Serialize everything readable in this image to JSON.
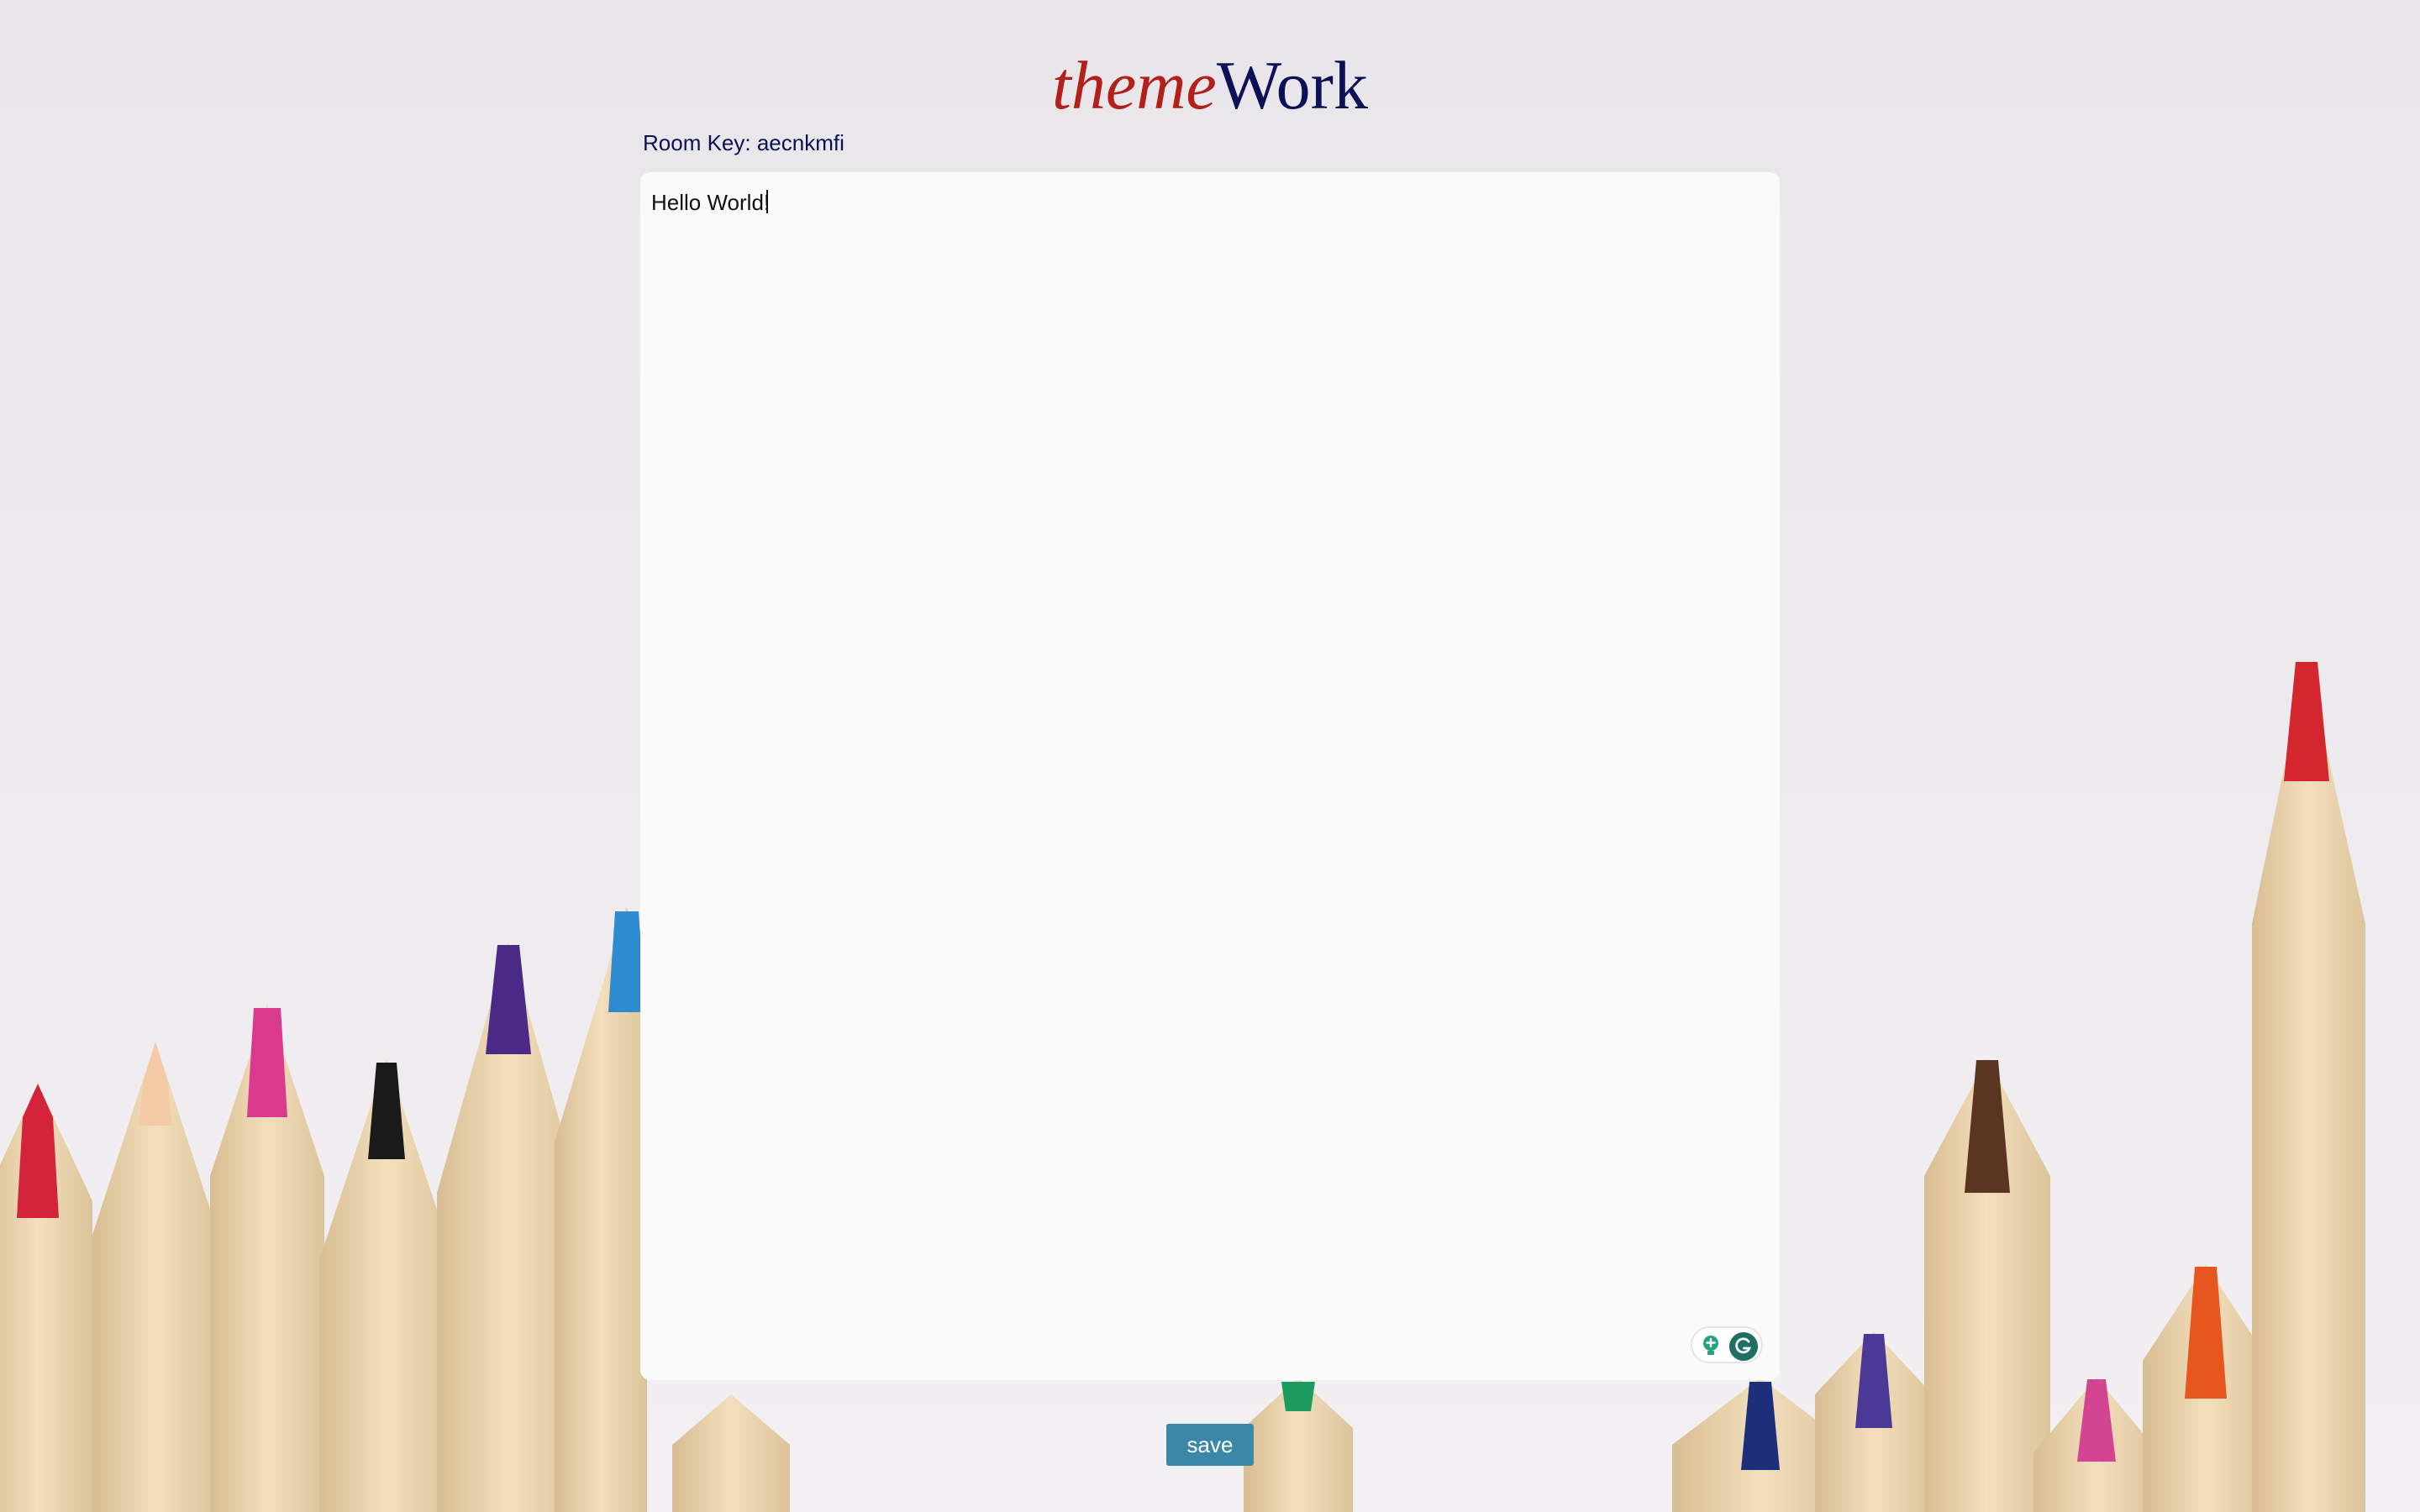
{
  "app": {
    "logo_part1": "theme",
    "logo_part2": "Work"
  },
  "room": {
    "label": "Room Key: aecnkmfi"
  },
  "editor": {
    "content": "Hello World!"
  },
  "actions": {
    "save_label": "save"
  },
  "colors": {
    "logo_theme": "#b3201b",
    "logo_work": "#0c1157",
    "save_button": "#3a87a8",
    "page_background": "#e9e7ea",
    "editor_background": "#fafafa"
  },
  "icons": {
    "assistant_suggestion": "lightbulb-icon",
    "assistant_logo": "grammarly-g-icon"
  }
}
